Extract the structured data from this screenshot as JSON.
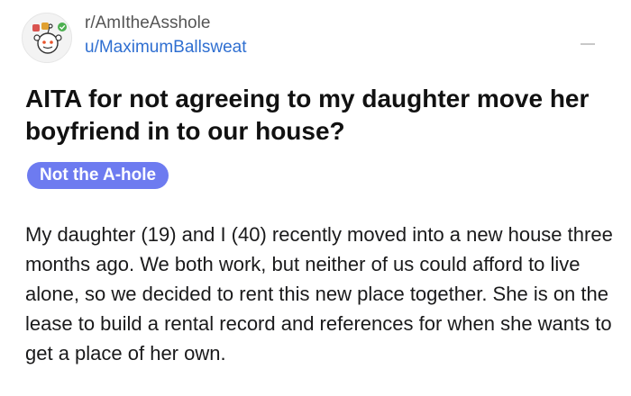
{
  "post": {
    "subreddit": "r/AmItheAsshole",
    "author": "u/MaximumBallsweat",
    "title": "AITA for not agreeing to my daughter move her boyfriend in to our house?",
    "flair": "Not the A-hole",
    "body": "My daughter (19) and I (40) recently moved into a new house three months ago. We both work, but neither of us could afford to live alone, so we decided to rent this new place together. She is on the lease to build a rental record and references for when she wants to get a place of her own."
  },
  "colors": {
    "username": "#2f6fd1",
    "flair_background": "#6d7bf0",
    "flair_text": "#ffffff"
  },
  "icons": {
    "avatar": "subreddit-avatar-icon",
    "more": "more-options-icon"
  }
}
